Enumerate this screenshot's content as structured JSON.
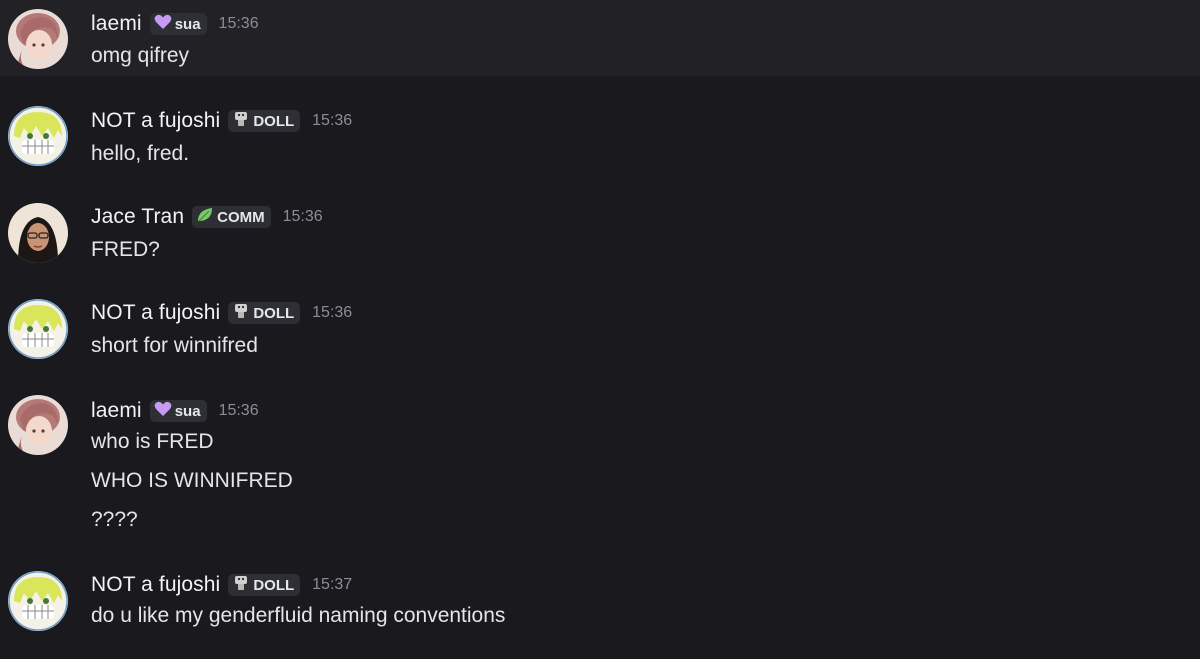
{
  "messages": [
    {
      "username": "laemi",
      "tag": "sua",
      "tag_icon": "purple-heart-icon",
      "time": "15:36",
      "lines": [
        "omg qifrey"
      ],
      "highlighted": true
    },
    {
      "username": "NOT a fujoshi",
      "tag": "DOLL",
      "tag_icon": "doll-icon",
      "time": "15:36",
      "lines": [
        "hello, fred."
      ]
    },
    {
      "username": "Jace Tran",
      "tag": "COMM",
      "tag_icon": "leaf-icon",
      "time": "15:36",
      "lines": [
        "FRED?"
      ]
    },
    {
      "username": "NOT a fujoshi",
      "tag": "DOLL",
      "tag_icon": "doll-icon",
      "time": "15:36",
      "lines": [
        "short for winnifred"
      ]
    },
    {
      "username": "laemi",
      "tag": "sua",
      "tag_icon": "purple-heart-icon",
      "time": "15:36",
      "lines": [
        "who is FRED",
        "WHO IS WINNIFRED",
        "????"
      ]
    },
    {
      "username": "NOT a fujoshi",
      "tag": "DOLL",
      "tag_icon": "doll-icon",
      "time": "15:37",
      "lines": [
        "do u like my genderfluid naming conventions"
      ]
    }
  ],
  "colors": {
    "background": "#1a1a1e",
    "highlight": "#222226",
    "username": "#f2f3f5",
    "timestamp": "#8b8e96",
    "tag_bg": "#2e2f35"
  }
}
